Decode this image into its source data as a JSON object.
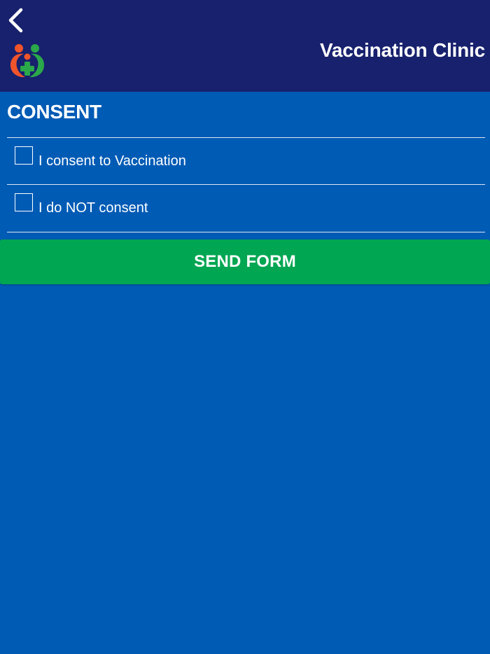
{
  "header": {
    "back_icon": "chevron-left-icon",
    "logo_icon": "clinic-logo-icon",
    "title": "Vaccination Clinic"
  },
  "form": {
    "section_title": "CONSENT",
    "options": [
      {
        "label": "I consent to Vaccination",
        "checked": false
      },
      {
        "label": "I do NOT consent",
        "checked": false
      }
    ],
    "submit_label": "SEND FORM"
  },
  "colors": {
    "header_bg": "#17216d",
    "page_bg": "#005bb5",
    "button_bg": "#00a652",
    "logo_orange": "#f0542b",
    "logo_green": "#2aa84a"
  }
}
